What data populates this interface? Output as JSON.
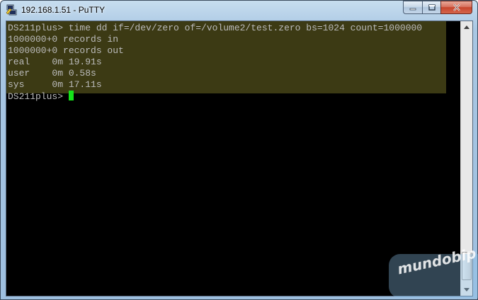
{
  "window": {
    "title": "192.168.1.51 - PuTTY",
    "icon": "putty-icon"
  },
  "controls": {
    "minimize": "minimize-icon",
    "maximize": "maximize-icon",
    "close": "close-icon"
  },
  "terminal": {
    "lines": [
      "DS211plus> time dd if=/dev/zero of=/volume2/test.zero bs=1024 count=1000000",
      "1000000+0 records in",
      "1000000+0 records out",
      "real    0m 19.91s",
      "user    0m 0.58s",
      "sys     0m 17.11s"
    ],
    "prompt": "DS211plus> ",
    "colors": {
      "background": "#000000",
      "text": "#bbbbbb",
      "selection": "#3c3a14",
      "cursor": "#15e21a"
    }
  },
  "scrollbar": {
    "up_icon": "scroll-up-arrow-icon",
    "down_icon": "scroll-down-arrow-icon"
  },
  "watermark": {
    "text": "mundobip"
  }
}
